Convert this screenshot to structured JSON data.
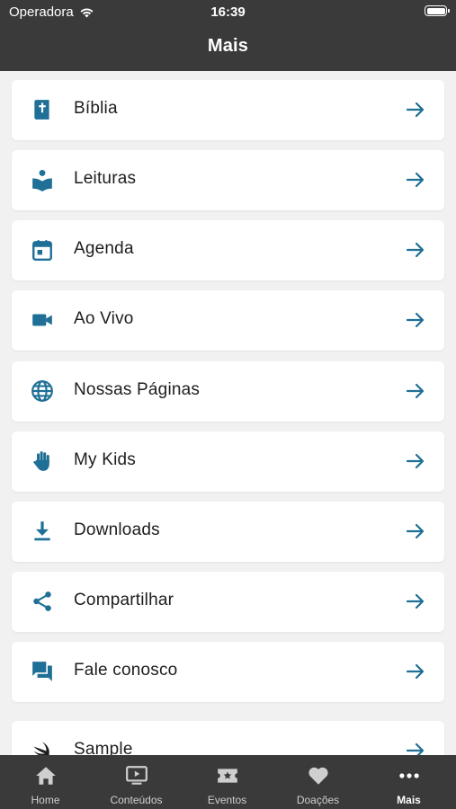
{
  "status_bar": {
    "carrier": "Operadora",
    "time": "16:39"
  },
  "header": {
    "title": "Mais"
  },
  "colors": {
    "accent": "#1f6f96",
    "header_bg": "#3a3a3a",
    "page_bg": "#f1f1f1"
  },
  "menu": {
    "items": [
      {
        "label": "Bíblia",
        "icon": "bible-icon"
      },
      {
        "label": "Leituras",
        "icon": "reading-icon"
      },
      {
        "label": "Agenda",
        "icon": "calendar-icon"
      },
      {
        "label": "Ao Vivo",
        "icon": "video-camera-icon"
      },
      {
        "label": "Nossas Páginas",
        "icon": "globe-icon"
      },
      {
        "label": "My Kids",
        "icon": "hand-icon"
      },
      {
        "label": "Downloads",
        "icon": "download-icon"
      },
      {
        "label": "Compartilhar",
        "icon": "share-icon"
      },
      {
        "label": "Fale conosco",
        "icon": "chat-icon"
      },
      {
        "label": "Sample",
        "icon": "swift-icon"
      }
    ]
  },
  "tabbar": {
    "tabs": [
      {
        "label": "Home",
        "icon": "home-icon"
      },
      {
        "label": "Conteúdos",
        "icon": "tv-icon"
      },
      {
        "label": "Eventos",
        "icon": "ticket-icon"
      },
      {
        "label": "Doações",
        "icon": "heart-icon"
      },
      {
        "label": "Mais",
        "icon": "more-icon"
      }
    ],
    "active": "Mais"
  }
}
